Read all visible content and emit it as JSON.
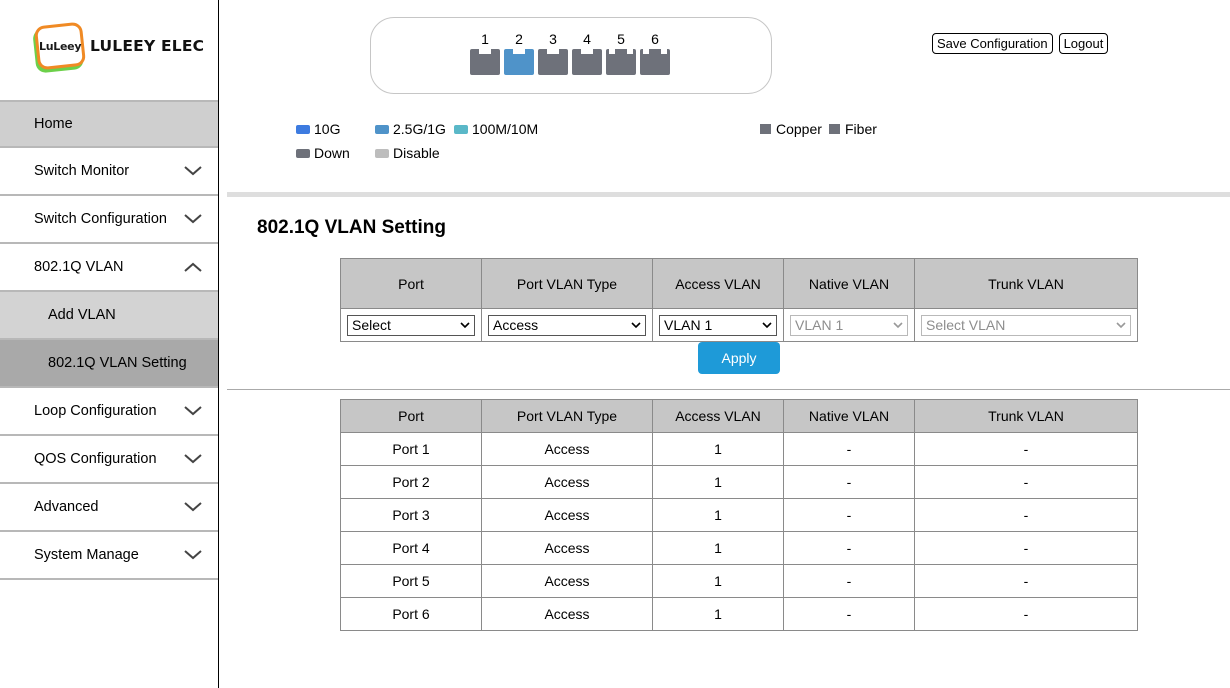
{
  "brand": {
    "badge_text": "LuLeey",
    "name": "LULEEY ELEC"
  },
  "sidebar": {
    "items": [
      {
        "label": "Home"
      },
      {
        "label": "Switch Monitor"
      },
      {
        "label": "Switch Configuration"
      },
      {
        "label": "802.1Q VLAN"
      },
      {
        "label": "Add VLAN"
      },
      {
        "label": "802.1Q VLAN Setting"
      },
      {
        "label": "Loop Configuration"
      },
      {
        "label": "QOS Configuration"
      },
      {
        "label": "Advanced"
      },
      {
        "label": "System Manage"
      }
    ]
  },
  "ports": [
    {
      "number": "1",
      "state": "down"
    },
    {
      "number": "2",
      "state": "2.5G/1G"
    },
    {
      "number": "3",
      "state": "down"
    },
    {
      "number": "4",
      "state": "down"
    },
    {
      "number": "5",
      "state": "down"
    },
    {
      "number": "6",
      "state": "down"
    }
  ],
  "header_buttons": {
    "save": "Save Configuration",
    "logout": "Logout"
  },
  "legend": {
    "speed_10g": "10G",
    "speed_2_5g": "2.5G/1G",
    "speed_100m": "100M/10M",
    "down": "Down",
    "disable": "Disable",
    "copper": "Copper",
    "fiber": "Fiber"
  },
  "colors": {
    "speed_10g": "#3d7be0",
    "speed_2_5g": "#4f93c9",
    "speed_100m": "#5ab8c8",
    "down": "#6e717a",
    "disable": "#bdbdbd",
    "accent": "#1e9ad8"
  },
  "section_title": "802.1Q VLAN Setting",
  "columns": [
    "Port",
    "Port VLAN Type",
    "Access VLAN",
    "Native VLAN",
    "Trunk VLAN"
  ],
  "form": {
    "port": "Select",
    "type": "Access",
    "access_vlan": "VLAN 1",
    "native_vlan": "VLAN 1",
    "trunk_vlan": "Select VLAN",
    "apply": "Apply"
  },
  "rows": [
    {
      "port": "Port 1",
      "type": "Access",
      "access": "1",
      "native": "-",
      "trunk": "-"
    },
    {
      "port": "Port 2",
      "type": "Access",
      "access": "1",
      "native": "-",
      "trunk": "-"
    },
    {
      "port": "Port 3",
      "type": "Access",
      "access": "1",
      "native": "-",
      "trunk": "-"
    },
    {
      "port": "Port 4",
      "type": "Access",
      "access": "1",
      "native": "-",
      "trunk": "-"
    },
    {
      "port": "Port 5",
      "type": "Access",
      "access": "1",
      "native": "-",
      "trunk": "-"
    },
    {
      "port": "Port 6",
      "type": "Access",
      "access": "1",
      "native": "-",
      "trunk": "-"
    }
  ]
}
